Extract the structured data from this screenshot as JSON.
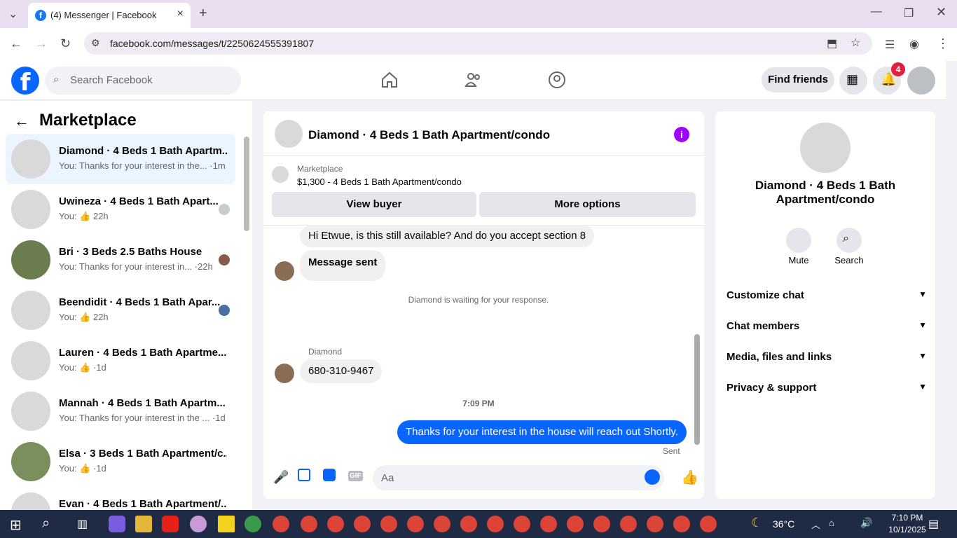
{
  "browser": {
    "tab_title": "(4) Messenger | Facebook",
    "url": "facebook.com/messages/t/2250624555391807"
  },
  "fb": {
    "search_placeholder": "Search Facebook",
    "find_friends": "Find friends",
    "notif_count": "4"
  },
  "left": {
    "title": "Marketplace",
    "conversations": [
      {
        "name": "Diamond · 4 Beds 1 Bath Apartm...",
        "preview": "You: Thanks for your interest in the... ·1m"
      },
      {
        "name": "Uwineza · 4 Beds 1 Bath Apart...",
        "preview": "You: 👍 22h"
      },
      {
        "name": "Bri · 3 Beds 2.5 Baths House",
        "preview": "You: Thanks for your interest in... ·22h"
      },
      {
        "name": "Beendidit · 4 Beds 1 Bath Apar...",
        "preview": "You: 👍 22h"
      },
      {
        "name": "Lauren · 4 Beds 1 Bath Apartme...",
        "preview": "You: 👍 ·1d"
      },
      {
        "name": "Mannah · 4 Beds 1 Bath Apartm...",
        "preview": "You: Thanks for your interest in the ... ·1d"
      },
      {
        "name": "Elsa · 3 Beds 1 Bath Apartment/c...",
        "preview": "You: 👍 ·1d"
      },
      {
        "name": "Evan · 4 Beds 1 Bath Apartment/...",
        "preview": ""
      }
    ]
  },
  "chat": {
    "title": "Diamond · 4 Beds 1 Bath Apartment/condo",
    "marketplace_label": "Marketplace",
    "listing": "$1,300 - 4 Beds 1 Bath Apartment/condo",
    "view_buyer": "View buyer",
    "more_options": "More options",
    "msg1": "Hi Etwue, is this still available? And do you accept section 8",
    "msg2": "Message sent",
    "waiting": "Diamond is waiting for your response.",
    "sender": "Diamond",
    "msg3": "680-310-9467",
    "time": "7:09 PM",
    "outgoing": "Thanks for your interest in the house will reach out Shortly.",
    "sent": "Sent",
    "composer_placeholder": "Aa"
  },
  "right": {
    "name": "Diamond · 4 Beds 1 Bath Apartment/condo",
    "mute": "Mute",
    "search": "Search",
    "rows": [
      "Customize chat",
      "Chat members",
      "Media, files and links",
      "Privacy & support"
    ]
  },
  "taskbar": {
    "temp": "36°C",
    "time": "7:10 PM",
    "date": "10/1/2025"
  }
}
